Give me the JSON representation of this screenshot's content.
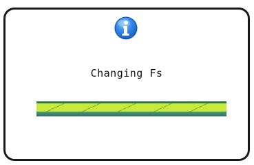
{
  "dialog": {
    "icon": "info-icon",
    "message": "Changing Fs",
    "progress": {
      "fraction": 1.0,
      "color_top": "#2f7a4a",
      "color_mid": "#c9ea3a",
      "color_bottom": "#2f6f67"
    }
  },
  "colors": {
    "border": "#1a1a1a",
    "info_icon_blue": "#1f6fd1"
  }
}
